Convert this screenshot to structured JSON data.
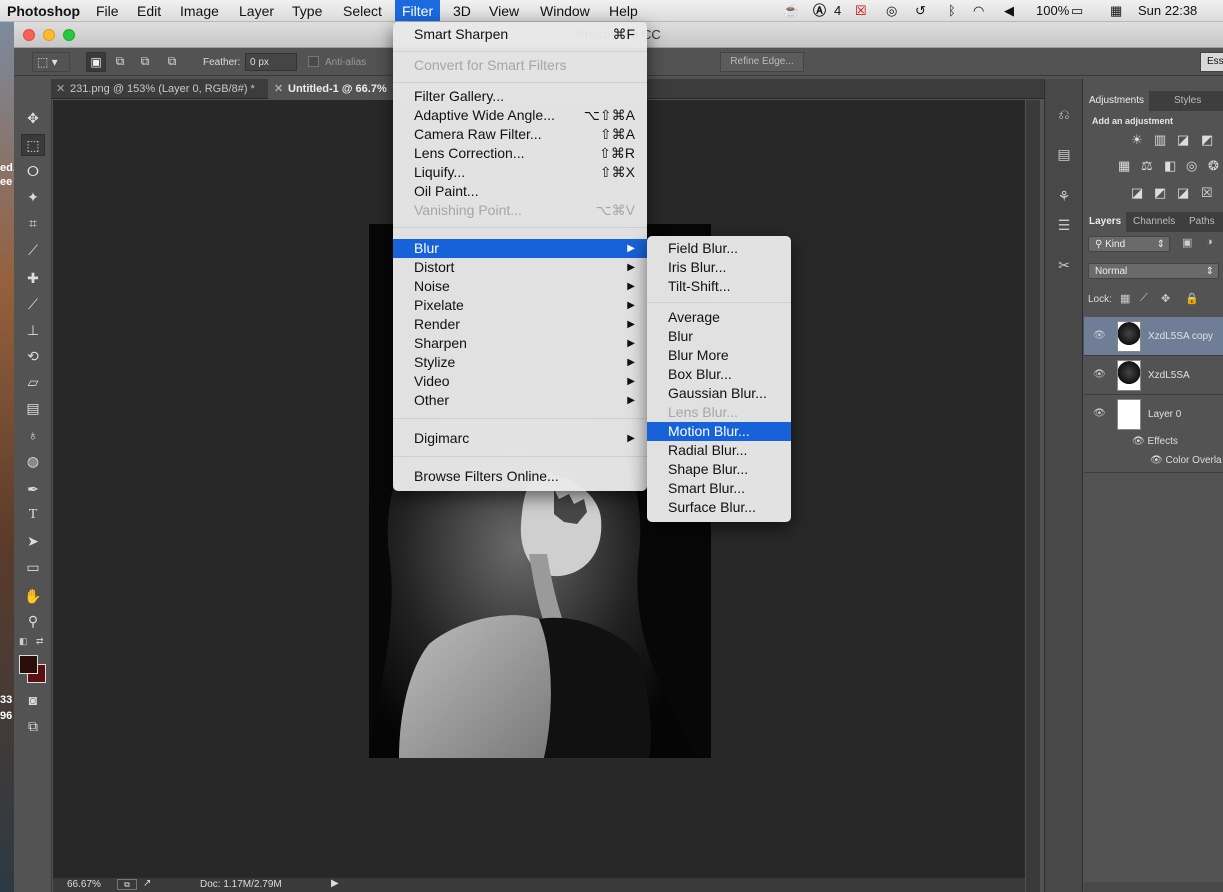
{
  "menubar": {
    "app": "Photoshop",
    "items": [
      "File",
      "Edit",
      "Image",
      "Layer",
      "Type",
      "Select",
      "Filter",
      "3D",
      "View",
      "Window",
      "Help"
    ],
    "active": "Filter",
    "status": {
      "adobe_count": "4",
      "battery": "100%",
      "date_time": "Sun 22:38"
    }
  },
  "window": {
    "title": "Photoshop CC"
  },
  "options": {
    "feather_label": "Feather:",
    "feather_value": "0 px",
    "antialias": "Anti-alias",
    "refine": "Refine Edge...",
    "workspace": "Esse"
  },
  "tabs": [
    {
      "label": "231.png @ 153% (Layer 0, RGB/8#) *",
      "close": "✕"
    },
    {
      "label": "Untitled-1 @ 66.7%",
      "close": "✕"
    }
  ],
  "statusbar": {
    "zoom": "66.67%",
    "doc": "Doc: 1.17M/2.79M"
  },
  "filter_menu": {
    "items": [
      {
        "label": "Smart Sharpen",
        "shortcut": "⌘F",
        "disabled": false
      },
      {
        "label": "Convert for Smart Filters",
        "shortcut": "",
        "disabled": true
      },
      {
        "label": "Filter Gallery...",
        "shortcut": "",
        "disabled": false
      },
      {
        "label": "Adaptive Wide Angle...",
        "shortcut": "⌥⇧⌘A",
        "disabled": false
      },
      {
        "label": "Camera Raw Filter...",
        "shortcut": "⇧⌘A",
        "disabled": false
      },
      {
        "label": "Lens Correction...",
        "shortcut": "⇧⌘R",
        "disabled": false
      },
      {
        "label": "Liquify...",
        "shortcut": "⇧⌘X",
        "disabled": false
      },
      {
        "label": "Oil Paint...",
        "shortcut": "",
        "disabled": false
      },
      {
        "label": "Vanishing Point...",
        "shortcut": "⌥⌘V",
        "disabled": true
      },
      {
        "label": "Blur",
        "submenu": true,
        "selected": true
      },
      {
        "label": "Distort",
        "submenu": true
      },
      {
        "label": "Noise",
        "submenu": true
      },
      {
        "label": "Pixelate",
        "submenu": true
      },
      {
        "label": "Render",
        "submenu": true
      },
      {
        "label": "Sharpen",
        "submenu": true
      },
      {
        "label": "Stylize",
        "submenu": true
      },
      {
        "label": "Video",
        "submenu": true
      },
      {
        "label": "Other",
        "submenu": true
      },
      {
        "label": "Digimarc",
        "submenu": true
      },
      {
        "label": "Browse Filters Online...",
        "shortcut": ""
      }
    ]
  },
  "blur_submenu": {
    "items": [
      {
        "label": "Field Blur..."
      },
      {
        "label": "Iris Blur..."
      },
      {
        "label": "Tilt-Shift..."
      },
      {
        "label": "Average"
      },
      {
        "label": "Blur"
      },
      {
        "label": "Blur More"
      },
      {
        "label": "Box Blur..."
      },
      {
        "label": "Gaussian Blur..."
      },
      {
        "label": "Lens Blur...",
        "disabled": true
      },
      {
        "label": "Motion Blur...",
        "selected": true
      },
      {
        "label": "Radial Blur..."
      },
      {
        "label": "Shape Blur..."
      },
      {
        "label": "Smart Blur..."
      },
      {
        "label": "Surface Blur..."
      }
    ]
  },
  "panels": {
    "adjustments_tabs": [
      "Adjustments",
      "Styles"
    ],
    "add_adjustment": "Add an adjustment",
    "layers_tabs": [
      "Layers",
      "Channels",
      "Paths"
    ],
    "kind": "Kind",
    "blend_mode": "Normal",
    "lock_label": "Lock:",
    "layers": [
      {
        "name": "XzdL5SA copy",
        "selected": true
      },
      {
        "name": "XzdL5SA",
        "selected": false
      },
      {
        "name": "Layer 0",
        "selected": false
      }
    ],
    "effects_label": "Effects",
    "effect_item": "Color Overla"
  },
  "desktop_edge": {
    "text1": "ed.",
    "text2": "ee",
    "num1": "33",
    "num2": "96"
  },
  "colors": {
    "accent": "#1762d8",
    "swatch_fg": "#2a0d08",
    "swatch_bg": "#5a1010"
  }
}
